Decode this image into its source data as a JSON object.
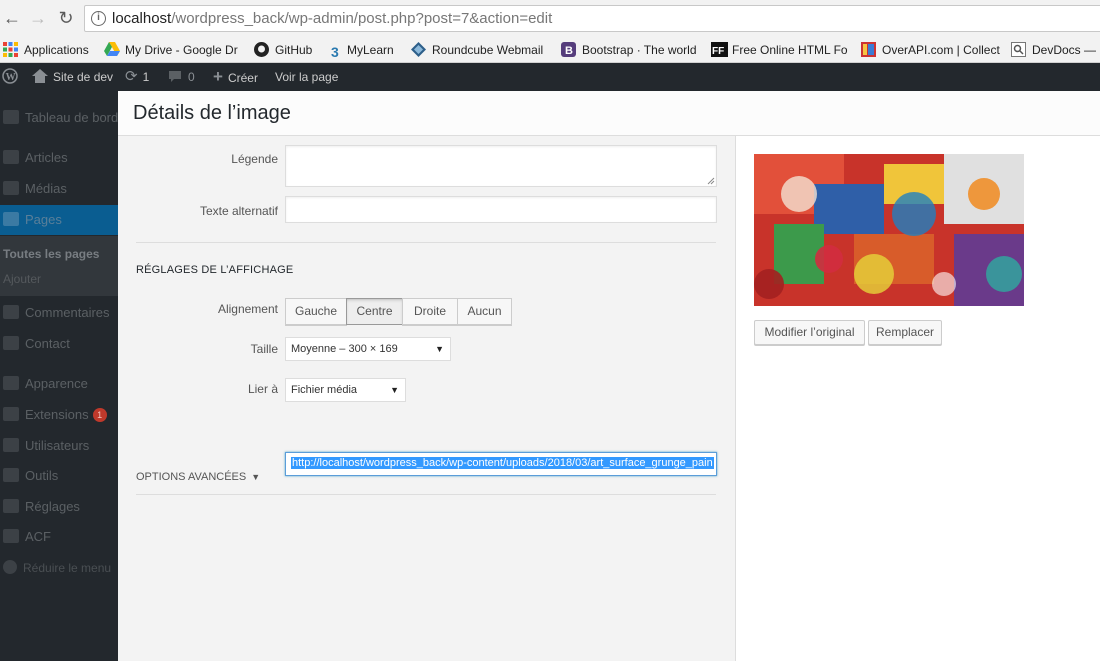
{
  "browser": {
    "url_host": "localhost",
    "url_path": "/wordpress_back/wp-admin/post.php?post=7&action=edit",
    "bookmarks": [
      "Applications",
      "My Drive - Google Dr",
      "GitHub",
      "MyLearn",
      "Roundcube Webmail",
      "Bootstrap · The world",
      "Free Online HTML Fo",
      "OverAPI.com | Collect",
      "DevDocs — ..."
    ]
  },
  "adminbar": {
    "site_name": "Site de dev",
    "updates_count": "1",
    "comments_count": "0",
    "new_label": "Créer",
    "view_label": "Voir la page"
  },
  "sidebar": {
    "items": [
      {
        "label": "Tableau de bord",
        "icon": "dashboard-icon"
      },
      {
        "label": "Articles",
        "icon": "pin-icon"
      },
      {
        "label": "Médias",
        "icon": "media-icon"
      },
      {
        "label": "Pages",
        "icon": "pages-icon"
      },
      {
        "label": "Commentaires",
        "icon": "comments-icon"
      },
      {
        "label": "Contact",
        "icon": "mail-icon"
      },
      {
        "label": "Apparence",
        "icon": "brush-icon"
      },
      {
        "label": "Extensions",
        "icon": "plugin-icon",
        "badge": "1"
      },
      {
        "label": "Utilisateurs",
        "icon": "users-icon"
      },
      {
        "label": "Outils",
        "icon": "tools-icon"
      },
      {
        "label": "Réglages",
        "icon": "settings-icon"
      },
      {
        "label": "ACF",
        "icon": "acf-icon"
      },
      {
        "label": "Réduire le menu",
        "icon": "collapse-icon"
      }
    ],
    "submenu": [
      "Toutes les pages",
      "Ajouter"
    ]
  },
  "modal": {
    "title": "Détails de l’image",
    "caption_label": "Légende",
    "caption_value": "",
    "alt_label": "Texte alternatif",
    "alt_value": "",
    "display_section": "RÉGLAGES DE L’AFFICHAGE",
    "alignment_label": "Alignement",
    "alignment_options": [
      "Gauche",
      "Centre",
      "Droite",
      "Aucun"
    ],
    "alignment_selected": "Centre",
    "size_label": "Taille",
    "size_value": "Moyenne – 300 × 169",
    "link_label": "Lier à",
    "link_value": "Fichier média",
    "link_url": "http://localhost/wordpress_back/wp-content/uploads/2018/03/art_surface_grunge_pain",
    "advanced_label": "OPTIONS AVANCÉES",
    "edit_original": "Modifier l’original",
    "replace": "Remplacer"
  },
  "colors": {
    "admin_dark": "#23282d",
    "active_menu": "#0a5d91",
    "selection": "#3399ff"
  }
}
